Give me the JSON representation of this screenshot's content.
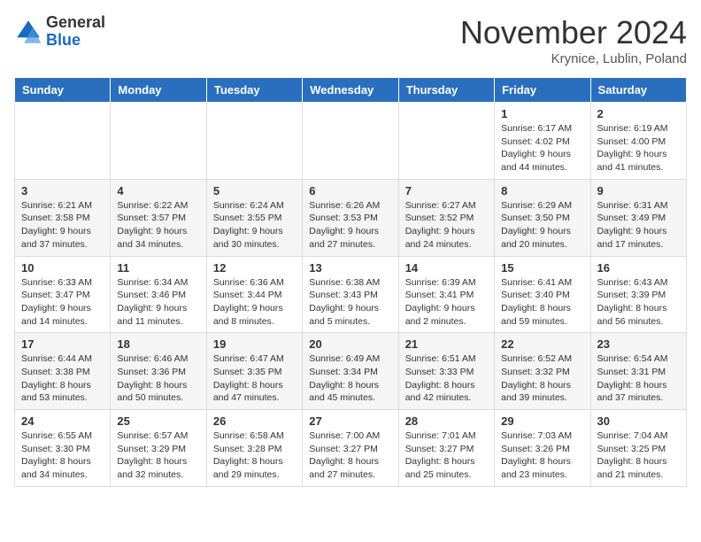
{
  "header": {
    "logo_general": "General",
    "logo_blue": "Blue",
    "month_title": "November 2024",
    "location": "Krynice, Lublin, Poland"
  },
  "weekdays": [
    "Sunday",
    "Monday",
    "Tuesday",
    "Wednesday",
    "Thursday",
    "Friday",
    "Saturday"
  ],
  "weeks": [
    [
      {
        "day": "",
        "info": ""
      },
      {
        "day": "",
        "info": ""
      },
      {
        "day": "",
        "info": ""
      },
      {
        "day": "",
        "info": ""
      },
      {
        "day": "",
        "info": ""
      },
      {
        "day": "1",
        "info": "Sunrise: 6:17 AM\nSunset: 4:02 PM\nDaylight: 9 hours\nand 44 minutes."
      },
      {
        "day": "2",
        "info": "Sunrise: 6:19 AM\nSunset: 4:00 PM\nDaylight: 9 hours\nand 41 minutes."
      }
    ],
    [
      {
        "day": "3",
        "info": "Sunrise: 6:21 AM\nSunset: 3:58 PM\nDaylight: 9 hours\nand 37 minutes."
      },
      {
        "day": "4",
        "info": "Sunrise: 6:22 AM\nSunset: 3:57 PM\nDaylight: 9 hours\nand 34 minutes."
      },
      {
        "day": "5",
        "info": "Sunrise: 6:24 AM\nSunset: 3:55 PM\nDaylight: 9 hours\nand 30 minutes."
      },
      {
        "day": "6",
        "info": "Sunrise: 6:26 AM\nSunset: 3:53 PM\nDaylight: 9 hours\nand 27 minutes."
      },
      {
        "day": "7",
        "info": "Sunrise: 6:27 AM\nSunset: 3:52 PM\nDaylight: 9 hours\nand 24 minutes."
      },
      {
        "day": "8",
        "info": "Sunrise: 6:29 AM\nSunset: 3:50 PM\nDaylight: 9 hours\nand 20 minutes."
      },
      {
        "day": "9",
        "info": "Sunrise: 6:31 AM\nSunset: 3:49 PM\nDaylight: 9 hours\nand 17 minutes."
      }
    ],
    [
      {
        "day": "10",
        "info": "Sunrise: 6:33 AM\nSunset: 3:47 PM\nDaylight: 9 hours\nand 14 minutes."
      },
      {
        "day": "11",
        "info": "Sunrise: 6:34 AM\nSunset: 3:46 PM\nDaylight: 9 hours\nand 11 minutes."
      },
      {
        "day": "12",
        "info": "Sunrise: 6:36 AM\nSunset: 3:44 PM\nDaylight: 9 hours\nand 8 minutes."
      },
      {
        "day": "13",
        "info": "Sunrise: 6:38 AM\nSunset: 3:43 PM\nDaylight: 9 hours\nand 5 minutes."
      },
      {
        "day": "14",
        "info": "Sunrise: 6:39 AM\nSunset: 3:41 PM\nDaylight: 9 hours\nand 2 minutes."
      },
      {
        "day": "15",
        "info": "Sunrise: 6:41 AM\nSunset: 3:40 PM\nDaylight: 8 hours\nand 59 minutes."
      },
      {
        "day": "16",
        "info": "Sunrise: 6:43 AM\nSunset: 3:39 PM\nDaylight: 8 hours\nand 56 minutes."
      }
    ],
    [
      {
        "day": "17",
        "info": "Sunrise: 6:44 AM\nSunset: 3:38 PM\nDaylight: 8 hours\nand 53 minutes."
      },
      {
        "day": "18",
        "info": "Sunrise: 6:46 AM\nSunset: 3:36 PM\nDaylight: 8 hours\nand 50 minutes."
      },
      {
        "day": "19",
        "info": "Sunrise: 6:47 AM\nSunset: 3:35 PM\nDaylight: 8 hours\nand 47 minutes."
      },
      {
        "day": "20",
        "info": "Sunrise: 6:49 AM\nSunset: 3:34 PM\nDaylight: 8 hours\nand 45 minutes."
      },
      {
        "day": "21",
        "info": "Sunrise: 6:51 AM\nSunset: 3:33 PM\nDaylight: 8 hours\nand 42 minutes."
      },
      {
        "day": "22",
        "info": "Sunrise: 6:52 AM\nSunset: 3:32 PM\nDaylight: 8 hours\nand 39 minutes."
      },
      {
        "day": "23",
        "info": "Sunrise: 6:54 AM\nSunset: 3:31 PM\nDaylight: 8 hours\nand 37 minutes."
      }
    ],
    [
      {
        "day": "24",
        "info": "Sunrise: 6:55 AM\nSunset: 3:30 PM\nDaylight: 8 hours\nand 34 minutes."
      },
      {
        "day": "25",
        "info": "Sunrise: 6:57 AM\nSunset: 3:29 PM\nDaylight: 8 hours\nand 32 minutes."
      },
      {
        "day": "26",
        "info": "Sunrise: 6:58 AM\nSunset: 3:28 PM\nDaylight: 8 hours\nand 29 minutes."
      },
      {
        "day": "27",
        "info": "Sunrise: 7:00 AM\nSunset: 3:27 PM\nDaylight: 8 hours\nand 27 minutes."
      },
      {
        "day": "28",
        "info": "Sunrise: 7:01 AM\nSunset: 3:27 PM\nDaylight: 8 hours\nand 25 minutes."
      },
      {
        "day": "29",
        "info": "Sunrise: 7:03 AM\nSunset: 3:26 PM\nDaylight: 8 hours\nand 23 minutes."
      },
      {
        "day": "30",
        "info": "Sunrise: 7:04 AM\nSunset: 3:25 PM\nDaylight: 8 hours\nand 21 minutes."
      }
    ]
  ]
}
